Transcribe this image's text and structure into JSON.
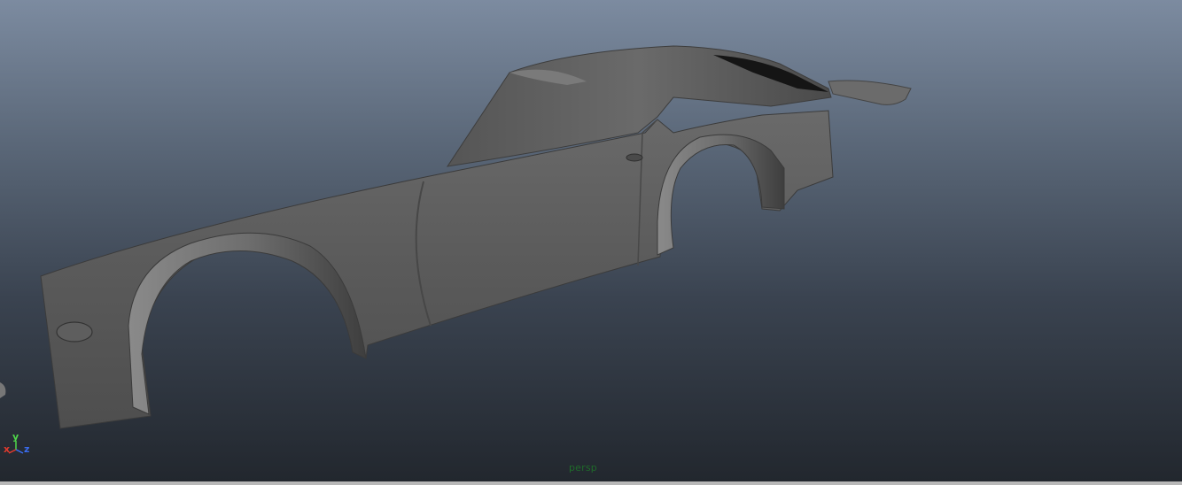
{
  "viewport": {
    "camera_label": "persp",
    "gradient_top": "#7c8ba0",
    "gradient_bottom": "#22272e"
  },
  "axis_gizmo": {
    "x_label": "x",
    "y_label": "y",
    "z_label": "z",
    "x_color": "#e03a2e",
    "y_color": "#4fd64a",
    "z_color": "#3a6cf0"
  },
  "model": {
    "surface_color": "#5c5c5c",
    "shadow_color": "#2f2f2f"
  }
}
